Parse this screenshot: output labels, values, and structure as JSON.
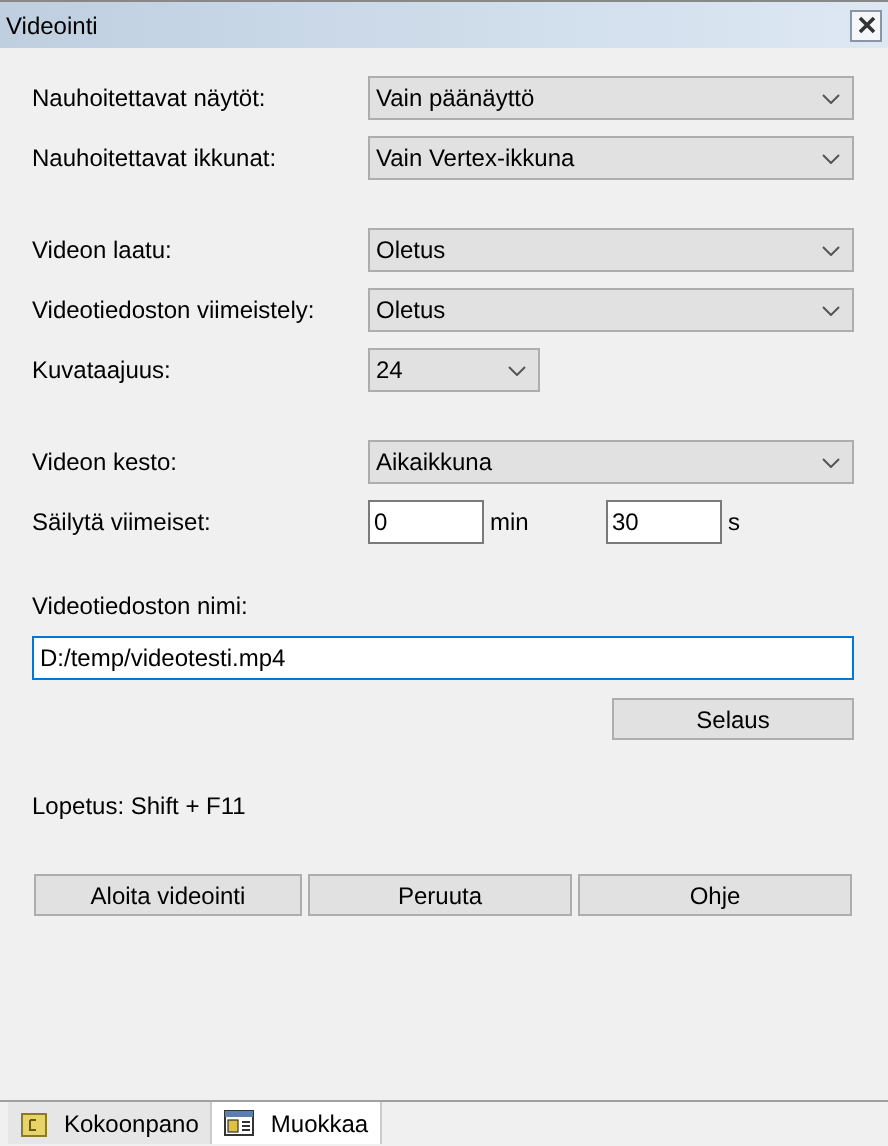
{
  "window": {
    "title": "Videointi"
  },
  "groups": [
    [
      {
        "kind": "dropdown",
        "label": "Nauhoitettavat näytöt:",
        "value": "Vain päänäyttö"
      },
      {
        "kind": "dropdown",
        "label": "Nauhoitettavat ikkunat:",
        "value": "Vain Vertex-ikkuna"
      }
    ],
    [
      {
        "kind": "dropdown",
        "label": "Videon laatu:",
        "value": "Oletus"
      },
      {
        "kind": "dropdown",
        "label": "Videotiedoston viimeistely:",
        "value": "Oletus"
      },
      {
        "kind": "smalldropdown",
        "label": "Kuvataajuus:",
        "value": "24"
      }
    ],
    [
      {
        "kind": "dropdown",
        "label": "Videon kesto:",
        "value": "Aikaikkuna"
      },
      {
        "kind": "duration",
        "label": "Säilytä viimeiset:",
        "minutes": "0",
        "minutes_unit": "min",
        "seconds": "30",
        "seconds_unit": "s"
      }
    ]
  ],
  "file": {
    "label": "Videotiedoston nimi:",
    "value": "D:/temp/videotesti.mp4",
    "browse": "Selaus"
  },
  "hint": "Lopetus: Shift + F11",
  "buttons": [
    "Aloita videointi",
    "Peruuta",
    "Ohje"
  ],
  "tabs": [
    {
      "label": "Kokoonpano",
      "selected": false
    },
    {
      "label": "Muokkaa",
      "selected": true
    }
  ]
}
